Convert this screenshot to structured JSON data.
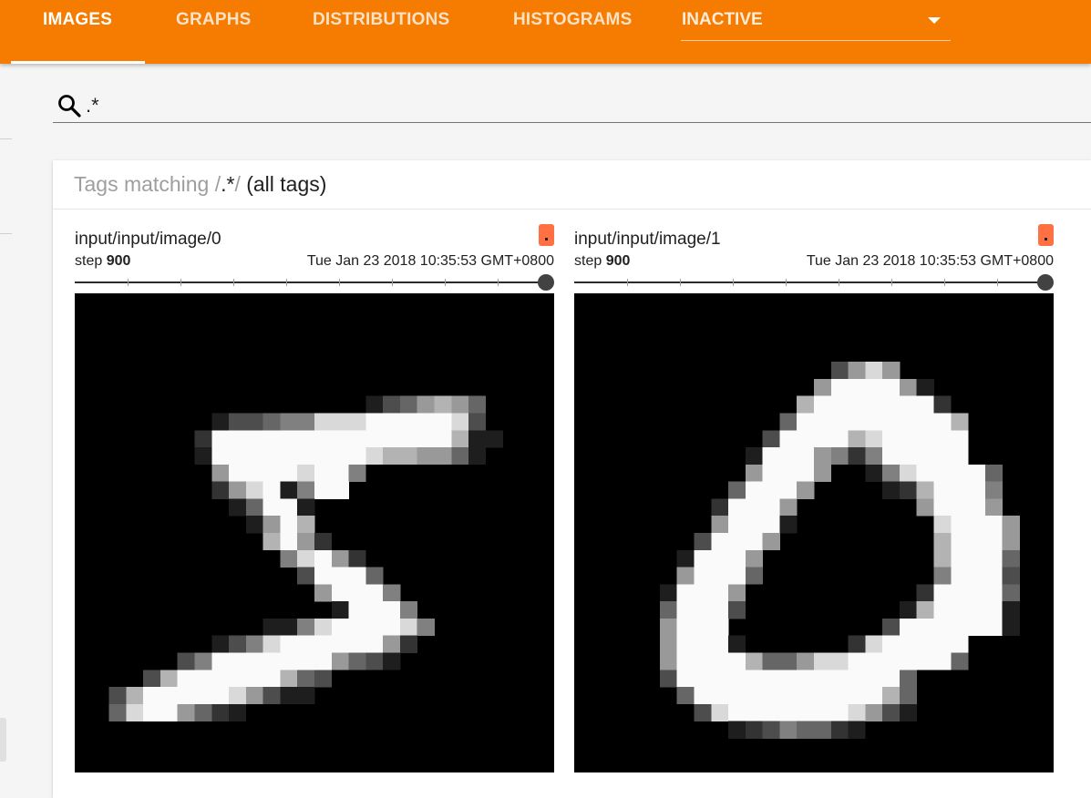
{
  "nav": {
    "tabs": [
      {
        "label": "IMAGES",
        "active": true
      },
      {
        "label": "GRAPHS",
        "active": false
      },
      {
        "label": "DISTRIBUTIONS",
        "active": false
      },
      {
        "label": "HISTOGRAMS",
        "active": false
      }
    ],
    "inactive_dropdown": "INACTIVE"
  },
  "search": {
    "value": ".*",
    "icon": "search-icon"
  },
  "tag_group": {
    "prefix": "Tags matching ",
    "regex_open": "/",
    "regex": ".*",
    "regex_close": "/",
    "suffix": " (all tags)"
  },
  "panels": [
    {
      "tag": "input/input/image/0",
      "step_label": "step",
      "step": "900",
      "wall_time": "Tue Jan 23 2018 10:35:53 GMT+0800",
      "run_color": "#ff7043",
      "slider_value": 1.0,
      "image_desc": "MNIST digit 5"
    },
    {
      "tag": "input/input/image/1",
      "step_label": "step",
      "step": "900",
      "wall_time": "Tue Jan 23 2018 10:35:53 GMT+0800",
      "run_color": "#ff7043",
      "slider_value": 1.0,
      "image_desc": "MNIST digit 0"
    }
  ],
  "colors": {
    "accent": "#f57c00",
    "run": "#ff7043"
  }
}
